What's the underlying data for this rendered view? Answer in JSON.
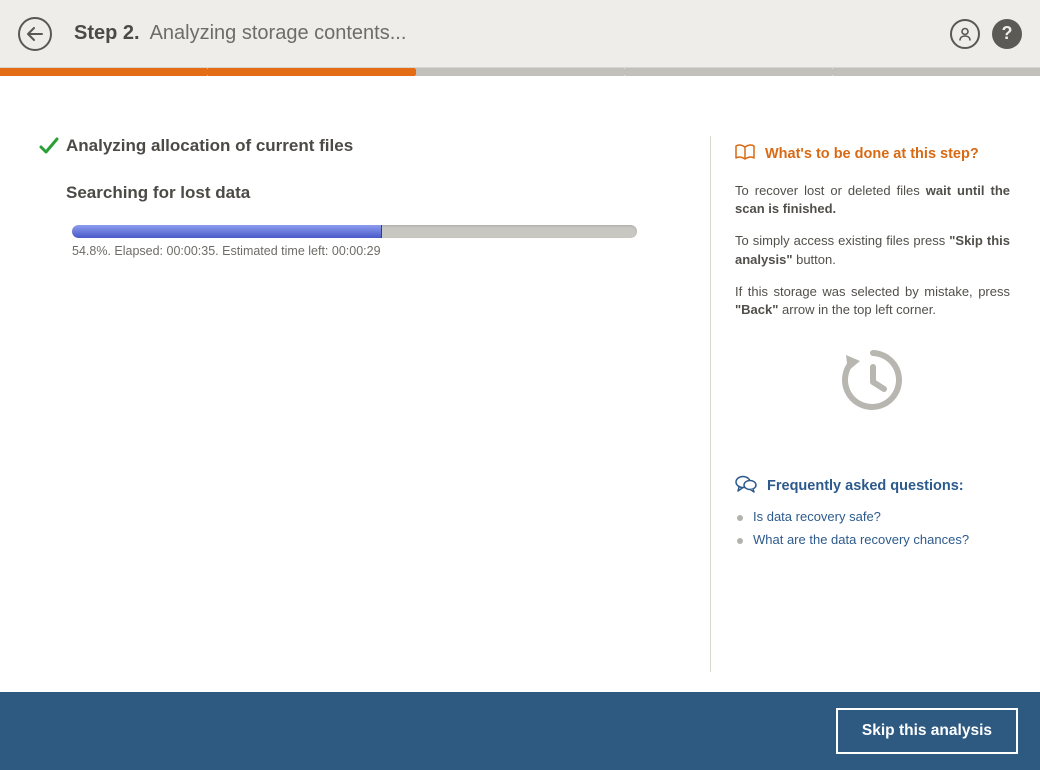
{
  "header": {
    "step_label": "Step 2.",
    "title": "Analyzing storage contents..."
  },
  "steps": {
    "total": 5,
    "done": 2
  },
  "main": {
    "task1": "Analyzing allocation of current files",
    "task2": "Searching for lost data",
    "progress_percent": 54.8,
    "progress_caption": "54.8%. Elapsed: 00:00:35. Estimated time left: 00:00:29"
  },
  "side": {
    "heading": "What's to be done at this step?",
    "p1_a": "To recover lost or deleted files ",
    "p1_b": "wait until the scan is finished.",
    "p2_a": "To simply access existing files press ",
    "p2_b": "\"Skip this analysis\"",
    "p2_c": " button.",
    "p3_a": "If this storage was selected by mistake, press ",
    "p3_b": "\"Back\"",
    "p3_c": " arrow in the top left corner.",
    "faq_heading": "Frequently asked questions:",
    "faq1": "Is data recovery safe?",
    "faq2": "What are the data recovery chances?"
  },
  "footer": {
    "skip_label": "Skip this analysis"
  },
  "colors": {
    "accent_orange": "#e46c14",
    "accent_blue": "#2e5a82",
    "progress_blue": "#4959c8"
  }
}
